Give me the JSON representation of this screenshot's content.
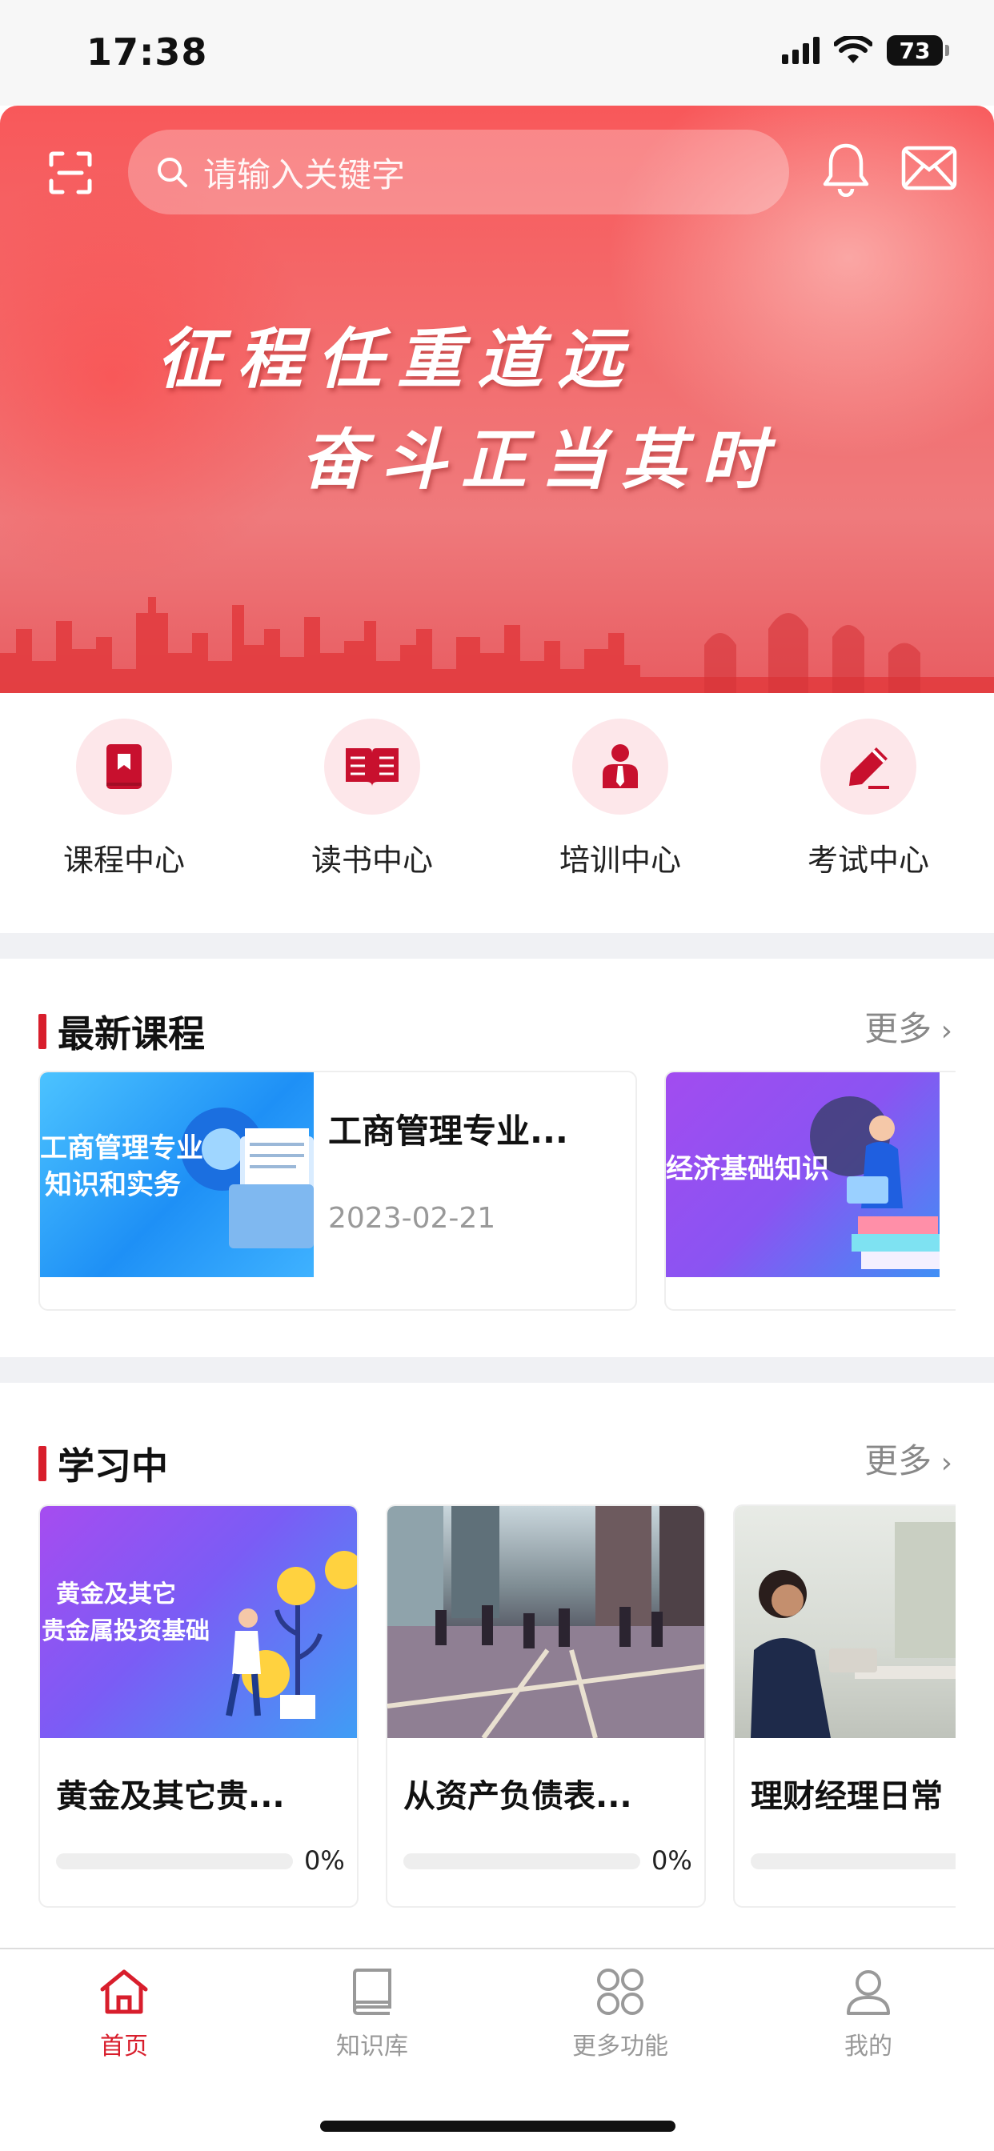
{
  "status_bar": {
    "time": "17:38",
    "battery": "73"
  },
  "header": {
    "search_placeholder": "请输入关键字"
  },
  "banner": {
    "line1": "征程任重道远",
    "line2": "奋斗正当其时"
  },
  "quick_entries": [
    {
      "label": "课程中心",
      "icon": "book-icon"
    },
    {
      "label": "读书中心",
      "icon": "open-book-icon"
    },
    {
      "label": "培训中心",
      "icon": "person-icon"
    },
    {
      "label": "考试中心",
      "icon": "pencil-icon"
    }
  ],
  "latest_courses": {
    "title": "最新课程",
    "more": "更多",
    "items": [
      {
        "title": "工商管理专业...",
        "date": "2023-02-21",
        "thumb_lines": [
          "工商管理专业",
          "知识和实务"
        ]
      },
      {
        "title": "",
        "date": "",
        "thumb_lines": [
          "经济基础知识"
        ]
      }
    ]
  },
  "studying": {
    "title": "学习中",
    "more": "更多",
    "items": [
      {
        "title": "黄金及其它贵...",
        "progress": 0,
        "progress_label": "0%",
        "thumb_lines": [
          "黄金及其它",
          "贵金属投资基础"
        ]
      },
      {
        "title": "从资产负债表...",
        "progress": 0,
        "progress_label": "0%"
      },
      {
        "title": "理财经理日常",
        "progress": 0,
        "progress_label": ""
      }
    ]
  },
  "tabbar": [
    {
      "label": "首页",
      "icon": "home-icon",
      "active": true
    },
    {
      "label": "知识库",
      "icon": "library-icon",
      "active": false
    },
    {
      "label": "更多功能",
      "icon": "grid-icon",
      "active": false
    },
    {
      "label": "我的",
      "icon": "user-icon",
      "active": false
    }
  ],
  "colors": {
    "accent": "#d81e2c",
    "banner": "#f36c6d",
    "divider": "#f0f1f4"
  }
}
